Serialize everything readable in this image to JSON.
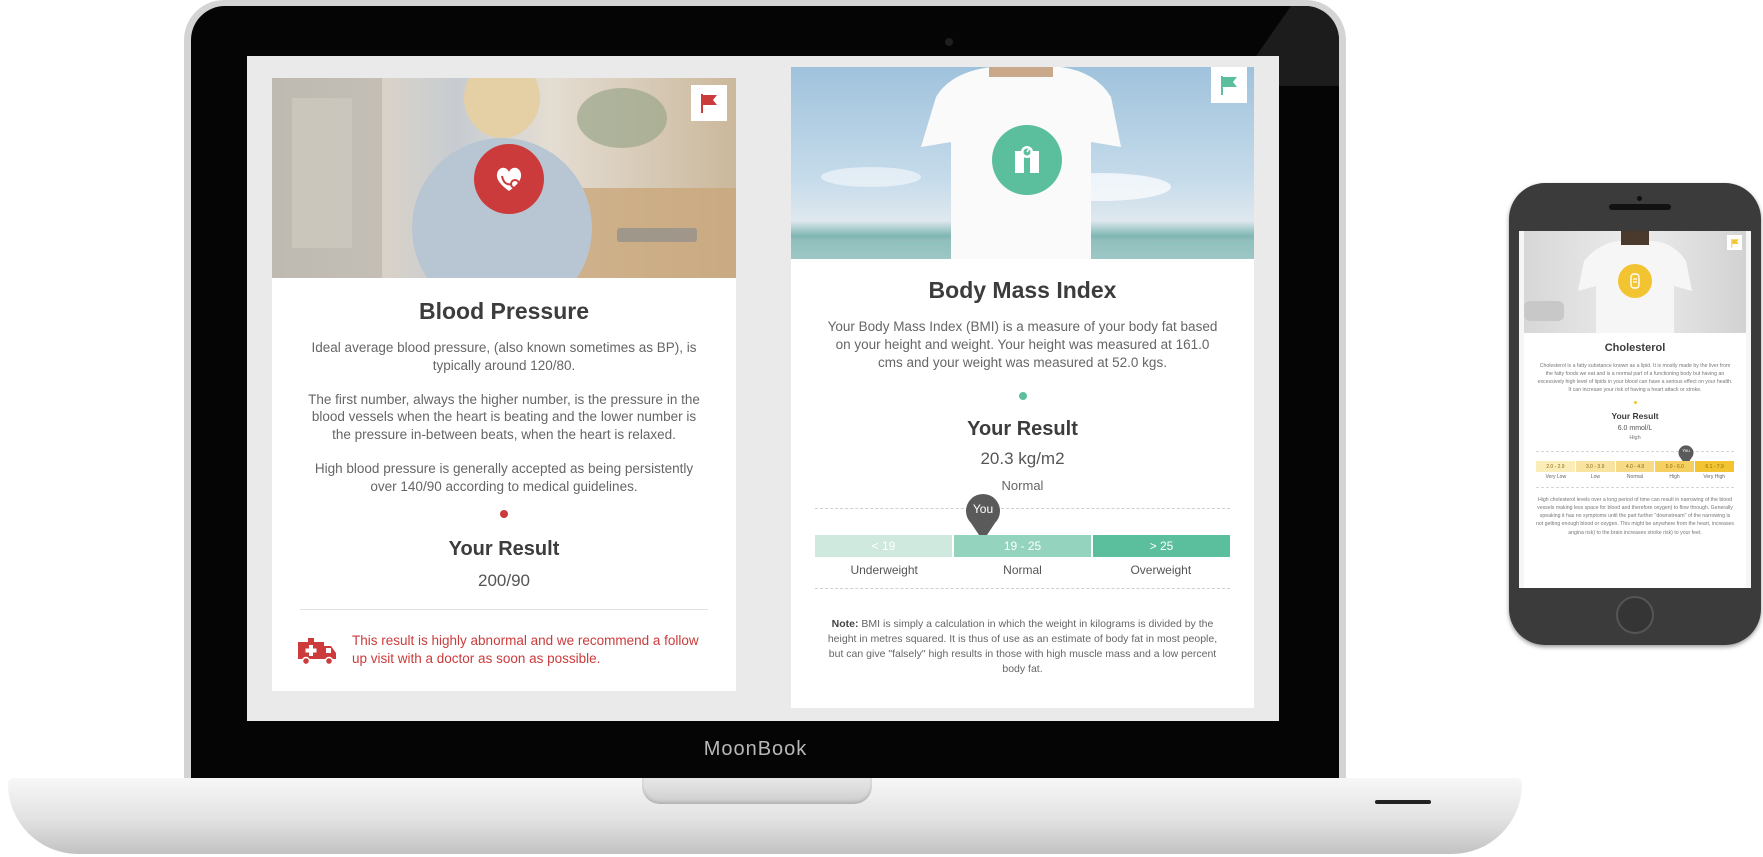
{
  "device": {
    "laptop_brand": "MoonBook"
  },
  "colors": {
    "bp_accent": "#cc3b3b",
    "bmi_accent": "#5bbf9e",
    "chol_accent": "#f3c431"
  },
  "blood_pressure": {
    "title": "Blood Pressure",
    "paragraphs": [
      "Ideal average blood pressure, (also known sometimes as BP), is typically around 120/80.",
      "The first number, always the higher number, is the pressure in the blood vessels when the heart is beating and the lower number is the pressure in-between beats, when the heart is relaxed.",
      "High blood pressure is generally accepted as being persistently over 140/90 according to medical guidelines."
    ],
    "result_title": "Your Result",
    "result_value": "200/90",
    "alert": "This result is highly abnormal and we recommend a follow up visit with a doctor as soon as possible.",
    "icons": {
      "badge": "heart-stethoscope-icon",
      "flag": "flag-icon",
      "alert": "ambulance-icon"
    }
  },
  "bmi": {
    "title": "Body Mass Index",
    "description": "Your Body Mass Index (BMI) is a measure of your body fat based on your height and weight. Your height was measured at 161.0 cms and your weight was measured at 52.0 kgs.",
    "result_title": "Your Result",
    "result_value": "20.3 kg/m2",
    "result_category": "Normal",
    "marker": "You",
    "scale": [
      {
        "range": "< 19",
        "label": "Underweight",
        "color": "#cfe9df"
      },
      {
        "range": "19 - 25",
        "label": "Normal",
        "color": "#94d3bd"
      },
      {
        "range": "> 25",
        "label": "Overweight",
        "color": "#5bbf9e"
      }
    ],
    "note_label": "Note:",
    "note": "BMI is simply a calculation in which the weight in kilograms is divided by the height in metres squared. It is thus of use as an estimate of body fat in most people, but can give \"falsely\" high results in those with high muscle mass and a low percent body fat.",
    "icons": {
      "badge": "scale-icon",
      "flag": "flag-icon"
    }
  },
  "cholesterol": {
    "title": "Cholesterol",
    "description": "Cholesterol is a fatty substance known as a lipid. It is mostly made by the liver from the fatty foods we eat and is a normal part of a functioning body but having an excessively high level of lipids in your blood can have a serious effect on your health. It can increase your risk of having a heart attack or stroke.",
    "result_title": "Your Result",
    "result_value": "6.0 mmol/L",
    "result_category": "High",
    "marker": "You",
    "scale": [
      {
        "range": "2.0 - 2.9",
        "label": "Very Low",
        "color": "#fbedb8"
      },
      {
        "range": "3.0 - 3.9",
        "label": "Low",
        "color": "#f9e3a0"
      },
      {
        "range": "4.0 - 4.9",
        "label": "Normal",
        "color": "#f7da85"
      },
      {
        "range": "5.0 - 6.0",
        "label": "High",
        "color": "#f5cf5f"
      },
      {
        "range": "6.1 - 7.9",
        "label": "Very High",
        "color": "#f3c431"
      }
    ],
    "footer": "High cholesterol levels over a long period of time can result in narrowing of the blood vessels making less space for blood and therefore oxygen) to flow through. Generally speaking it has no symptoms until the part further \"downstream\" of the narrowing is not getting enough blood or oxygen. This might be anywhere from the heart, increases angina risk) to the brain increases stroke risk) to your feet.",
    "icons": {
      "badge": "cholesterol-icon",
      "flag": "flag-icon"
    }
  }
}
